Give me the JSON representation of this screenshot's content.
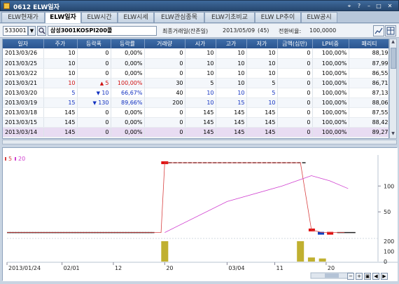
{
  "window": {
    "title": "0612 ELW일자",
    "controls": [
      "⌖",
      "?",
      "–",
      "□",
      "✕"
    ]
  },
  "tabs": [
    {
      "label": "ELW현재가",
      "active": false
    },
    {
      "label": "ELW일자",
      "active": true
    },
    {
      "label": "ELW시간",
      "active": false
    },
    {
      "label": "ELW시세",
      "active": false
    },
    {
      "label": "ELW관심종목",
      "active": false
    },
    {
      "label": "ELW기초비교",
      "active": false
    },
    {
      "label": "ELW LP추이",
      "active": false
    },
    {
      "label": "ELW공시",
      "active": false
    }
  ],
  "search": {
    "code": "533001",
    "name": "삼성3001KOSPI200콜",
    "last_trade_label": "최종거래일(잔존일)",
    "last_trade_value": "2013/05/09",
    "remaining": "(45)",
    "conversion_label": "전환비율:",
    "conversion_value": "100,0000"
  },
  "grid": {
    "columns": [
      "일자",
      "주가",
      "등락폭",
      "등락률",
      "거래량",
      "시가",
      "고가",
      "저가",
      "금액(십만)",
      "LP비중",
      "패리티"
    ],
    "rows": [
      {
        "date": "2013/03/26",
        "price": "10",
        "dir": "",
        "change": "0",
        "rate": "0,00%",
        "volume": "0",
        "open": "10",
        "high": "10",
        "low": "10",
        "amount": "0",
        "lp": "100,00%",
        "parity": "88,19",
        "cls": ""
      },
      {
        "date": "2013/03/25",
        "price": "10",
        "dir": "",
        "change": "0",
        "rate": "0,00%",
        "volume": "0",
        "open": "10",
        "high": "10",
        "low": "10",
        "amount": "0",
        "lp": "100,00%",
        "parity": "87,99",
        "cls": ""
      },
      {
        "date": "2013/03/22",
        "price": "10",
        "dir": "",
        "change": "0",
        "rate": "0,00%",
        "volume": "0",
        "open": "10",
        "high": "10",
        "low": "10",
        "amount": "0",
        "lp": "100,00%",
        "parity": "86,55",
        "cls": ""
      },
      {
        "date": "2013/03/21",
        "price": "10",
        "dir": "up",
        "change": "5",
        "rate": "100,00%",
        "volume": "30",
        "open": "5",
        "high": "10",
        "low": "5",
        "amount": "0",
        "lp": "100,00%",
        "parity": "86,71",
        "cls": "up"
      },
      {
        "date": "2013/03/20",
        "price": "5",
        "dir": "dn",
        "change": "10",
        "rate": "66,67%",
        "volume": "40",
        "open": "10",
        "high": "10",
        "low": "5",
        "amount": "0",
        "lp": "100,00%",
        "parity": "87,13",
        "cls": "dn"
      },
      {
        "date": "2013/03/19",
        "price": "15",
        "dir": "dn",
        "change": "130",
        "rate": "89,66%",
        "volume": "200",
        "open": "10",
        "high": "15",
        "low": "10",
        "amount": "0",
        "lp": "100,00%",
        "parity": "88,06",
        "cls": "dn"
      },
      {
        "date": "2013/03/18",
        "price": "145",
        "dir": "",
        "change": "0",
        "rate": "0,00%",
        "volume": "0",
        "open": "145",
        "high": "145",
        "low": "145",
        "amount": "0",
        "lp": "100,00%",
        "parity": "87,55",
        "cls": ""
      },
      {
        "date": "2013/03/15",
        "price": "145",
        "dir": "",
        "change": "0",
        "rate": "0,00%",
        "volume": "0",
        "open": "145",
        "high": "145",
        "low": "145",
        "amount": "0",
        "lp": "100,00%",
        "parity": "88,42",
        "cls": ""
      },
      {
        "date": "2013/03/14",
        "price": "145",
        "dir": "",
        "change": "0",
        "rate": "0,00%",
        "volume": "0",
        "open": "145",
        "high": "145",
        "low": "145",
        "amount": "0",
        "lp": "100,00%",
        "parity": "89,27",
        "cls": ""
      }
    ]
  },
  "chart_data": {
    "type": "line",
    "legend": [
      "5",
      "20"
    ],
    "y_ticks_price": [
      "100",
      "50"
    ],
    "y_ticks_volume": [
      "200",
      "100",
      "0"
    ],
    "x_ticks": [
      "2013/01/24",
      "02/01",
      "12",
      "20",
      "03/04",
      "11",
      "20"
    ],
    "price_series": [
      {
        "x": 0,
        "y": 10
      },
      {
        "x": 0.42,
        "y": 10
      },
      {
        "x": 0.43,
        "y": 145
      },
      {
        "x": 0.8,
        "y": 145
      },
      {
        "x": 0.83,
        "y": 15
      },
      {
        "x": 0.86,
        "y": 10
      },
      {
        "x": 0.92,
        "y": 10
      }
    ],
    "ma20_series": [
      {
        "x": 0.43,
        "y": 10
      },
      {
        "x": 0.6,
        "y": 70
      },
      {
        "x": 0.75,
        "y": 100
      },
      {
        "x": 0.83,
        "y": 120
      },
      {
        "x": 0.88,
        "y": 110
      },
      {
        "x": 0.93,
        "y": 95
      }
    ],
    "volume_bars": [
      {
        "x": 0.43,
        "v": 200
      },
      {
        "x": 0.8,
        "v": 200
      },
      {
        "x": 0.83,
        "v": 40
      },
      {
        "x": 0.86,
        "v": 30
      }
    ],
    "colors": {
      "price": "#d84040",
      "ma20": "#d040d0",
      "volume": "#c0b030",
      "up": "#e01010",
      "down": "#1040c0"
    }
  }
}
